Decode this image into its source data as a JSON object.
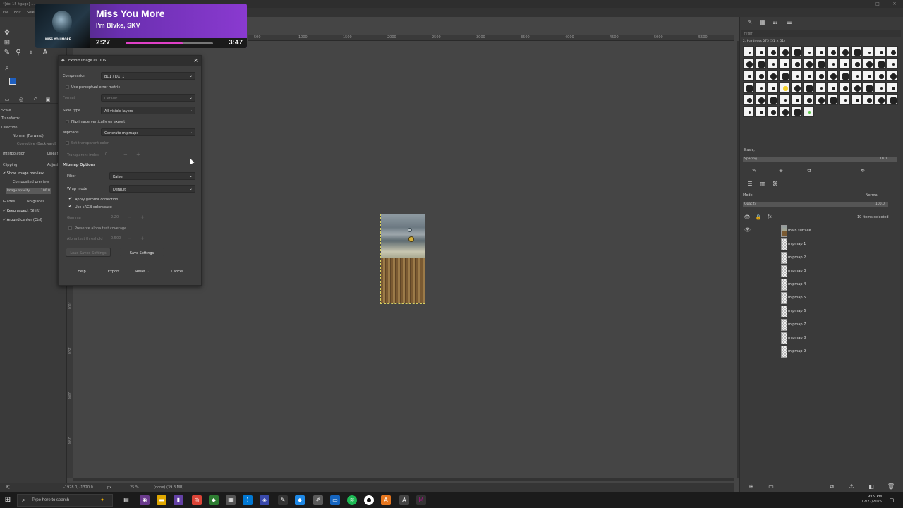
{
  "window": {
    "title": "*[do_15_tgage]-...",
    "menus": [
      "File",
      "Edit",
      "Select"
    ]
  },
  "music": {
    "title": "Miss You More",
    "artist": "I'm Blvke, SKV",
    "current_time": "2:27",
    "total_time": "3:47",
    "art_text": "MISS YOU MORE",
    "progress": 0.65
  },
  "tool_options": {
    "scale": "Scale",
    "transform": "Transform:",
    "direction": "Direction",
    "normal": "Normal (Forward)",
    "corrective": "Corrective (Backward)",
    "interpolation": "Interpolation",
    "interpolation_value": "Linear",
    "clipping": "Clipping",
    "clipping_value": "Adjust",
    "show_preview": "Show image preview",
    "composited": "Composited preview",
    "image_opacity": "Image opacity",
    "image_opacity_value": "100.0",
    "guides": "Guides",
    "guides_value": "No guides",
    "keep_aspect": "Keep aspect (Shift)",
    "around_center": "Around center (Ctrl)"
  },
  "dialog": {
    "title": "Export Image as DDS",
    "compression_label": "Compression",
    "compression_value": "BC1 / DXT1",
    "perceptual": "Use perceptual error metric",
    "format_label": "Format",
    "format_value": "Default",
    "save_type_label": "Save type",
    "save_type_value": "All visible layers",
    "flip": "Flip image vertically on export",
    "mipmaps_label": "Mipmaps",
    "mipmaps_value": "Generate mipmaps",
    "transparent_color": "Set transparent color",
    "transparent_index": "Transparent index",
    "transparent_index_value": "0",
    "mipmap_options": "Mipmap Options",
    "filter_label": "Filter",
    "filter_value": "Kaiser",
    "wrap_label": "Wrap mode",
    "wrap_value": "Default",
    "gamma_correction": "Apply gamma correction",
    "srgb": "Use sRGB colorspace",
    "gamma_label": "Gamma",
    "gamma_value": "2.20",
    "preserve_alpha": "Preserve alpha test coverage",
    "alpha_threshold_label": "Alpha test threshold",
    "alpha_threshold_value": "0.500",
    "load_settings": "Load Saved Settings",
    "save_settings": "Save Settings",
    "help": "Help",
    "export": "Export",
    "reset": "Reset",
    "cancel": "Cancel"
  },
  "ruler": {
    "h_ticks": [
      "500",
      "1000",
      "1500",
      "2000",
      "2500",
      "3000",
      "3500",
      "4000",
      "4500",
      "5000",
      "5500"
    ],
    "v_ticks": [
      "1000",
      "1500",
      "2000",
      "2500",
      "3000"
    ]
  },
  "status": {
    "coords": "-1928.0, -1320.0",
    "unit": "px",
    "zoom": "25 %",
    "info": "(none) (39.3 MB)"
  },
  "brushes": {
    "filter_placeholder": "filter",
    "current": "2. Hardness 075 (51 × 51)",
    "preset": "Basic,",
    "spacing_label": "Spacing",
    "spacing_value": "10.0"
  },
  "layers": {
    "mode_label": "Mode",
    "mode_value": "Normal",
    "opacity_label": "Opacity",
    "opacity_value": "100.0",
    "lock_label": "Lock:",
    "selected_count": "10 items selected",
    "items": [
      "main surface",
      "mipmap 1",
      "mipmap 2",
      "mipmap 3",
      "mipmap 4",
      "mipmap 5",
      "mipmap 6",
      "mipmap 7",
      "mipmap 8",
      "mipmap 9"
    ]
  },
  "taskbar": {
    "search_placeholder": "Type here to search",
    "time": "9:09 PM",
    "date": "12/27/2025"
  }
}
